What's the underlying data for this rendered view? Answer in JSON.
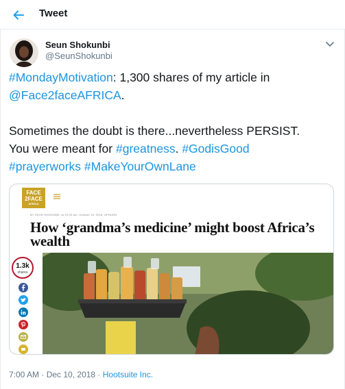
{
  "header": {
    "title": "Tweet",
    "back_icon": "back-arrow-icon"
  },
  "author": {
    "name": "Seun Shokunbi",
    "handle": "@SeunShokunbi",
    "more_icon": "chevron-down-icon"
  },
  "tweet": {
    "line1_tag": "#MondayMotivation",
    "line1_text": ": 1,300 shares of my article in",
    "line2_mention": "@Face2faceAFRICA",
    "line2_text": ".",
    "line3": "Sometimes the doubt is there...nevertheless PERSIST.",
    "line4_text": "You were meant for ",
    "tag_greatness": "#greatness",
    "line4_dot": ".",
    "tag_godisgood": "#GodisGood",
    "tag_prayerworks": "#prayerworks",
    "tag_makeyourownlane": "#MakeYourOwnLane"
  },
  "card": {
    "logo_line1": "FACE",
    "logo_line2": "2FACE",
    "logo_line3": "AFRICA",
    "byline": "BY SEUN SHOKUNBI, at 10:00 am, October 19, 2018, OPINION",
    "headline": "How ‘grandma’s medicine’ might boost Africa’s wealth",
    "share_count": "1.3k",
    "share_label": "shares",
    "social_icons": [
      "facebook-icon",
      "twitter-icon",
      "linkedin-icon",
      "pinterest-icon",
      "email-icon",
      "whatsapp-icon"
    ]
  },
  "meta": {
    "time": "7:00 AM",
    "sep1": " · ",
    "date": "Dec 10, 2018",
    "sep2": " · ",
    "source": "Hootsuite Inc."
  },
  "colors": {
    "link": "#1b95e0",
    "text": "#14171a",
    "muted": "#657786",
    "share_ring": "#b5162b",
    "logo": "#c9a227"
  }
}
